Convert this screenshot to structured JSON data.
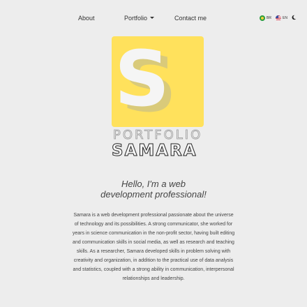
{
  "nav": {
    "about": "About",
    "portfolio": "Portfolio",
    "contact": "Contact me"
  },
  "languages": [
    {
      "code": "BR"
    },
    {
      "code": "EN"
    }
  ],
  "theme_toggle_icon": "moon-icon",
  "logo": {
    "letter": "S",
    "word_top": "PORTFOLIO",
    "word_bottom": "SAMARA",
    "accent_color": "#ffe15c"
  },
  "headline": {
    "line1": "Hello, I'm a web",
    "line2": "development professional!"
  },
  "bio": "Samara is a web development professional passionate about the universe of technology and its possibilities. A strong communicator, she worked for years in science communication in the non-profit sector, having built editing and communication skills in social media, as well as research and teaching skills. As a researcher, Samara developed skills in problem solving with creativity and organization, in addition to the practical use of data analysis and statistics, coupled with a strong ability in communication, interpersonal relationships and leadership."
}
